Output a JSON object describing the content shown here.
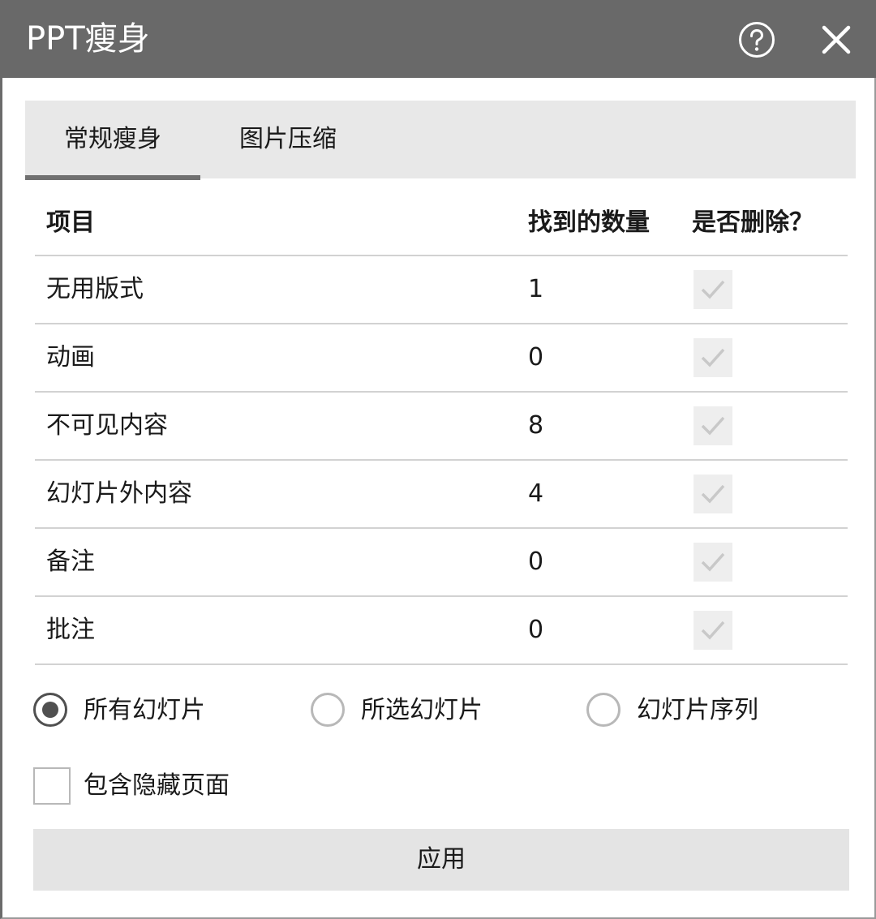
{
  "window": {
    "title": "PPT瘦身",
    "help_icon": "help-circle-icon",
    "close_icon": "close-icon"
  },
  "tabs": [
    {
      "label": "常规瘦身",
      "active": true
    },
    {
      "label": "图片压缩",
      "active": false
    }
  ],
  "table": {
    "headers": {
      "item": "项目",
      "count": "找到的数量",
      "delete": "是否删除？"
    },
    "rows": [
      {
        "item": "无用版式",
        "count": "1",
        "checked": true
      },
      {
        "item": "动画",
        "count": "0",
        "checked": true
      },
      {
        "item": "不可见内容",
        "count": "8",
        "checked": true
      },
      {
        "item": "幻灯片外内容",
        "count": "4",
        "checked": true
      },
      {
        "item": "备注",
        "count": "0",
        "checked": true
      },
      {
        "item": "批注",
        "count": "0",
        "checked": true
      }
    ]
  },
  "scope": {
    "options": [
      {
        "label": "所有幻灯片",
        "selected": true
      },
      {
        "label": "所选幻灯片",
        "selected": false
      },
      {
        "label": "幻灯片序列",
        "selected": false
      }
    ]
  },
  "include_hidden": {
    "label": "包含隐藏页面",
    "checked": false
  },
  "apply_button": {
    "label": "应用"
  },
  "colors": {
    "titlebar": "#696969",
    "tabbar": "#e8e8e8",
    "button": "#e4e4e4",
    "check_disabled": "#c8c8c8"
  }
}
